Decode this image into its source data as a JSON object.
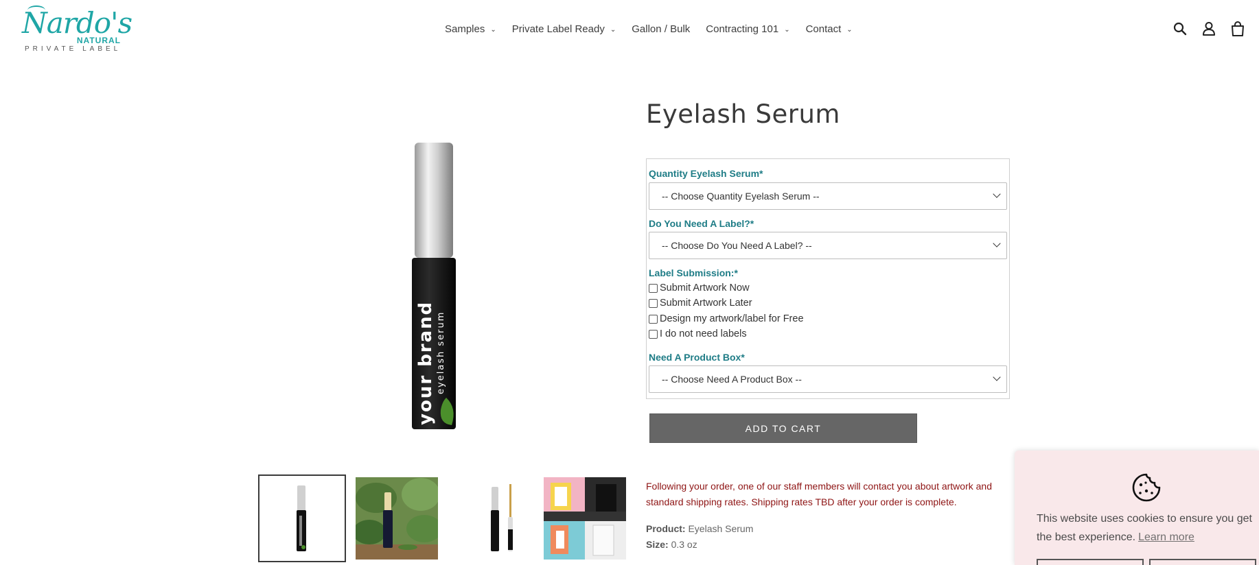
{
  "brand": {
    "logo_script": "Nardo's",
    "logo_sub": "NATURAL",
    "logo_tagline": "PRIVATE LABEL",
    "accent_color": "#1fa6a6"
  },
  "nav": {
    "items": [
      {
        "label": "Samples",
        "has_dropdown": true
      },
      {
        "label": "Private Label Ready",
        "has_dropdown": true
      },
      {
        "label": "Gallon / Bulk",
        "has_dropdown": false
      },
      {
        "label": "Contracting 101",
        "has_dropdown": true
      },
      {
        "label": "Contact",
        "has_dropdown": true
      }
    ],
    "icons": [
      "search-icon",
      "account-icon",
      "cart-icon"
    ]
  },
  "product": {
    "title": "Eyelash Serum",
    "image_brand_text": "your brand",
    "image_product_text": "eyelash serum",
    "thumbnails": [
      "bottle-front",
      "bottle-leaves",
      "bottle-with-wand",
      "box-mockups"
    ]
  },
  "form": {
    "quantity": {
      "label": "Quantity Eyelash Serum*",
      "placeholder": "-- Choose Quantity Eyelash Serum --"
    },
    "need_label": {
      "label": "Do You Need A Label?*",
      "placeholder": "-- Choose Do You Need A Label? --"
    },
    "label_submission": {
      "label": "Label Submission:*",
      "options": [
        "Submit Artwork Now",
        "Submit Artwork Later",
        "Design my artwork/label for Free",
        "I do not need labels"
      ]
    },
    "product_box": {
      "label": "Need A Product Box*",
      "placeholder": "-- Choose Need A Product Box --"
    },
    "label_color": "#1e7c86"
  },
  "add_to_cart": "ADD TO CART",
  "notice": "Following your order, one of our staff members will contact you about artwork and standard shipping rates. Shipping rates TBD after your order is complete.",
  "meta": {
    "product_label": "Product:",
    "product_value": "Eyelash Serum",
    "size_label": "Size:",
    "size_value": "0.3 oz"
  },
  "cookie": {
    "message": "This website uses cookies to ensure you get the best experience.",
    "learn_more": "Learn more",
    "background": "#f9e8ea"
  }
}
